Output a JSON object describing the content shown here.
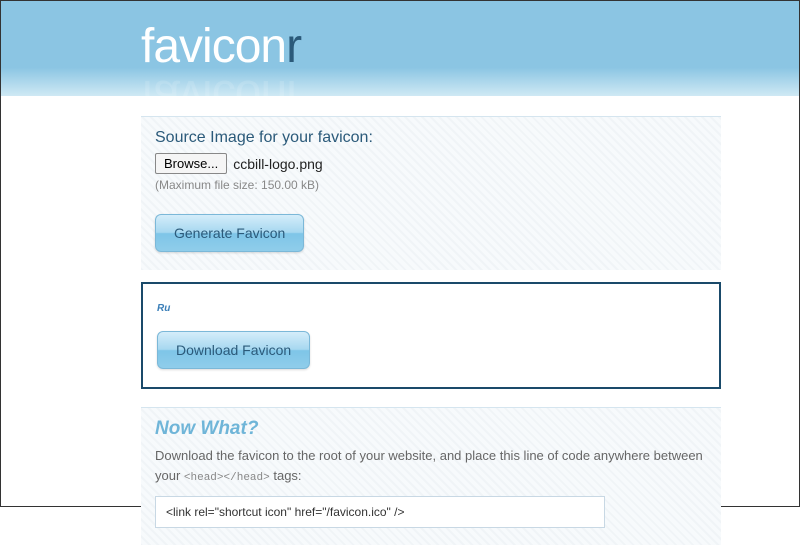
{
  "logo": {
    "text1": "favicon",
    "text2": "r"
  },
  "upload": {
    "label": "Source Image for your favicon:",
    "browse": "Browse...",
    "filename": "ccbill-logo.png",
    "maxsize": "(Maximum file size: 150.00 kB)",
    "generate": "Generate Favicon"
  },
  "result": {
    "preview_text": "Ru",
    "download": "Download Favicon"
  },
  "nowwhat": {
    "title": "Now What?",
    "text_part1": "Download the favicon to the root of your website, and place this line of code anywhere between your ",
    "head_tags": "<head></head>",
    "text_part2": " tags:",
    "code": "<link rel=\"shortcut icon\" href=\"/favicon.ico\" />"
  }
}
